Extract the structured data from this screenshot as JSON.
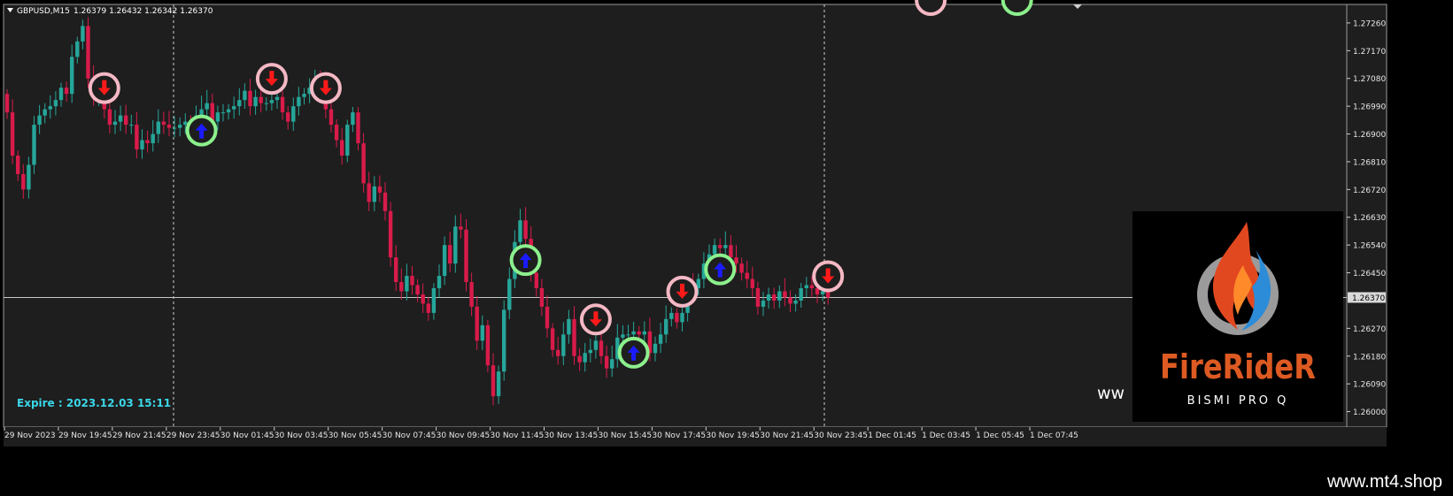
{
  "header": {
    "symbol_timeframe": "GBPUSD,M15",
    "ohlc": "1.26379 1.26432 1.26342 1.26370"
  },
  "expire_text": "Expire : 2023.12.03 15:11",
  "partial_url": "ww",
  "logo": {
    "name": "FireRideR",
    "subtitle": "BISMI PRO Q"
  },
  "footer_url": "www.mt4.shop",
  "colors": {
    "background": "#1e1e1e",
    "bull": "#26a69a",
    "bear": "#d81b4a",
    "sell_signal_ring": "#f4b8c4",
    "sell_arrow": "#ff1a1a",
    "buy_signal_ring": "#8cf08c",
    "buy_arrow": "#1b1bff",
    "expire_text": "#3ad7e8"
  },
  "chart_data": {
    "type": "candlestick",
    "symbol": "GBPUSD",
    "timeframe": "M15",
    "current_price": 1.2637,
    "ylim": [
      1.2595,
      1.2732
    ],
    "price_ticks": [
      1.2726,
      1.2717,
      1.2708,
      1.2699,
      1.269,
      1.2681,
      1.2672,
      1.2663,
      1.2654,
      1.2645,
      1.2627,
      1.2618,
      1.2609,
      1.26
    ],
    "price_tick_labels": [
      "1.27260",
      "1.27170",
      "1.27080",
      "1.26990",
      "1.26900",
      "1.26810",
      "1.26720",
      "1.26630",
      "1.26540",
      "1.26450",
      "1.26270",
      "1.26180",
      "1.26090",
      "1.26000"
    ],
    "current_price_label": "1.26370",
    "time_labels": [
      "29 Nov 2023",
      "29 Nov 19:45",
      "29 Nov 21:45",
      "29 Nov 23:45",
      "30 Nov 01:45",
      "30 Nov 03:45",
      "30 Nov 05:45",
      "30 Nov 07:45",
      "30 Nov 09:45",
      "30 Nov 11:45",
      "30 Nov 13:45",
      "30 Nov 15:45",
      "30 Nov 17:45",
      "30 Nov 19:45",
      "30 Nov 21:45",
      "30 Nov 23:45",
      "1 Dec 01:45",
      "1 Dec 03:45",
      "1 Dec 05:45",
      "1 Dec 07:45"
    ],
    "closes": [
      1.2697,
      1.2683,
      1.2677,
      1.2672,
      1.268,
      1.2693,
      1.2696,
      1.2698,
      1.2699,
      1.2701,
      1.2705,
      1.2703,
      1.2715,
      1.272,
      1.2725,
      1.2708,
      1.2702,
      1.2704,
      1.2698,
      1.2693,
      1.2694,
      1.2696,
      1.2693,
      1.2693,
      1.2685,
      1.2688,
      1.2687,
      1.269,
      1.2694,
      1.2693,
      1.2692,
      1.2692,
      1.2693,
      1.2694,
      1.2693,
      1.2696,
      1.2698,
      1.27,
      1.2694,
      1.2697,
      1.2697,
      1.2698,
      1.2699,
      1.2701,
      1.2704,
      1.2699,
      1.2702,
      1.27,
      1.27,
      1.2701,
      1.2702,
      1.2697,
      1.2694,
      1.2699,
      1.2702,
      1.2703,
      1.2705,
      1.2707,
      1.2706,
      1.2698,
      1.2693,
      1.2688,
      1.2683,
      1.2693,
      1.2697,
      1.2687,
      1.2674,
      1.2668,
      1.2673,
      1.2671,
      1.2665,
      1.265,
      1.2642,
      1.2639,
      1.2644,
      1.2641,
      1.2638,
      1.2635,
      1.2632,
      1.264,
      1.2644,
      1.2654,
      1.2648,
      1.266,
      1.2659,
      1.2642,
      1.2634,
      1.2623,
      1.2628,
      1.2615,
      1.2605,
      1.2613,
      1.2633,
      1.2643,
      1.2655,
      1.2662,
      1.2656,
      1.2645,
      1.264,
      1.2634,
      1.2627,
      1.262,
      1.2618,
      1.2625,
      1.263,
      1.2618,
      1.2616,
      1.2619,
      1.262,
      1.2623,
      1.2618,
      1.2614,
      1.2617,
      1.2624,
      1.2625,
      1.2625,
      1.2626,
      1.2625,
      1.2626,
      1.2619,
      1.2622,
      1.2625,
      1.263,
      1.2632,
      1.2629,
      1.2632,
      1.2641,
      1.264,
      1.2643,
      1.2648,
      1.2651,
      1.2654,
      1.2653,
      1.2654,
      1.265,
      1.2648,
      1.2645,
      1.2643,
      1.264,
      1.2634,
      1.2636,
      1.2638,
      1.2636,
      1.2639,
      1.2637,
      1.2635,
      1.2636,
      1.264,
      1.2641,
      1.264,
      1.2638,
      1.2639,
      1.2637
    ]
  }
}
